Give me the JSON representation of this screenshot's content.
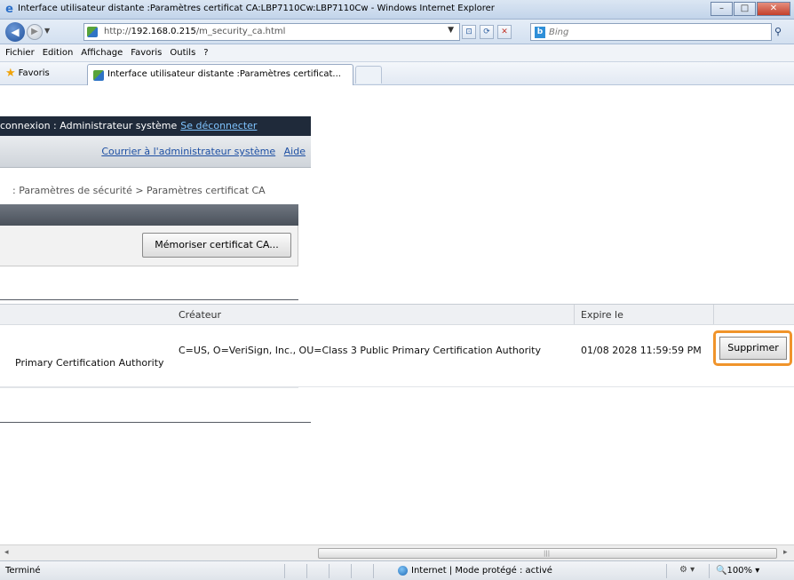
{
  "window": {
    "title": "Interface utilisateur distante :Paramètres certificat CA:LBP7110Cw:LBP7110Cw - Windows Internet Explorer",
    "buttons": {
      "minimize": "–",
      "maximize": "□",
      "close": "✕"
    }
  },
  "address": {
    "url_prefix": "http://",
    "url_host": "192.168.0.215",
    "url_path": "/m_security_ca.html"
  },
  "search": {
    "placeholder": "Bing"
  },
  "menu": [
    "Fichier",
    "Edition",
    "Affichage",
    "Favoris",
    "Outils",
    "?"
  ],
  "favorites": {
    "label": "Favoris",
    "tab_title": "Interface utilisateur distante :Paramètres certificat..."
  },
  "page": {
    "login_text": "connexion : Administrateur système",
    "logout_link": "Se déconnecter",
    "mail_link": "Courrier à l'administrateur système",
    "help_link": "Aide",
    "breadcrumb": ": Paramètres de sécurité > Paramètres certificat CA",
    "store_button": "Mémoriser certificat CA...",
    "table": {
      "headers": {
        "issuer": "Créateur",
        "expires": "Expire le"
      },
      "rows": [
        {
          "name": "Primary Certification Authority",
          "issuer": "C=US, O=VeriSign, Inc., OU=Class 3 Public Primary Certification Authority",
          "expires": "01/08 2028 11:59:59 PM",
          "action": "Supprimer"
        }
      ]
    }
  },
  "status": {
    "text": "Terminé",
    "zone": "Internet | Mode protégé : activé",
    "zoom": "100%"
  },
  "icons": {
    "ie_logo": "e",
    "back": "◀",
    "forward": "▶",
    "star": "★",
    "globe": "globe"
  },
  "colors": {
    "highlight": "#f0942b",
    "login_strip": "#1f2a3a",
    "link": "#1d4fa3"
  }
}
